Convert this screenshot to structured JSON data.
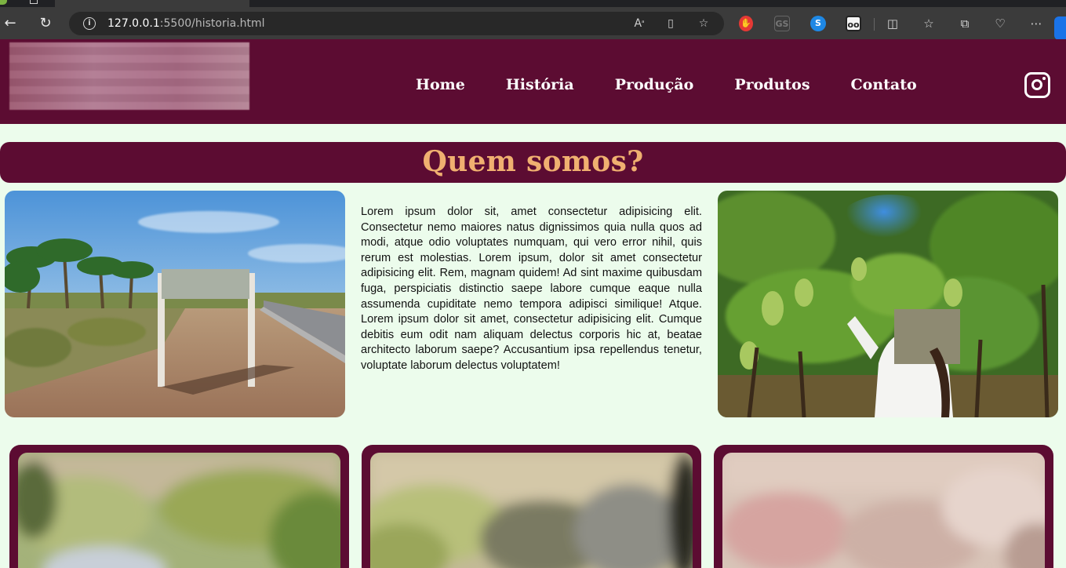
{
  "browser": {
    "url_host": "127.0.0.1",
    "url_rest": ":5500/historia.html",
    "toolbar_icons": [
      "back-arrow-icon",
      "reload-icon",
      "info-icon",
      "read-aloud-icon",
      "immersive-reader-icon",
      "favorite-star-icon",
      "split-screen-icon",
      "favorites-icon",
      "collections-icon",
      "browser-essentials-icon",
      "more-menu-icon"
    ],
    "extensions": [
      "red-extension-icon",
      "gray-extension-icon",
      "shazam-extension-icon",
      "eye-extension-icon"
    ]
  },
  "header": {
    "nav": [
      "Home",
      "História",
      "Produção",
      "Produtos",
      "Contato"
    ],
    "social_icon": "instagram-icon"
  },
  "section": {
    "title": "Quem somos?",
    "body": "Lorem ipsum dolor sit, amet consectetur adipisicing elit. Consectetur nemo maiores natus dignissimos quia nulla quos ad modi, atque odio voluptates numquam, qui vero error nihil, quis rerum est molestias. Lorem ipsum, dolor sit amet consectetur adipisicing elit. Rem, magnam quidem! Ad sint maxime quibusdam fuga, perspiciatis distinctio saepe labore cumque eaque nulla assumenda cupiditate nemo tempora adipisci similique! Atque. Lorem ipsum dolor sit amet, consectetur adipisicing elit. Cumque debitis eum odit nam aliquam delectus corporis hic at, beatae architecto laborum saepe? Accusantium ipsa repellendus tenetur, voluptate laborum delectus voluptatem!"
  },
  "colors": {
    "brand": "#5c0c32",
    "title_accent": "#f0b070",
    "page_bg": "#ecfcec"
  }
}
